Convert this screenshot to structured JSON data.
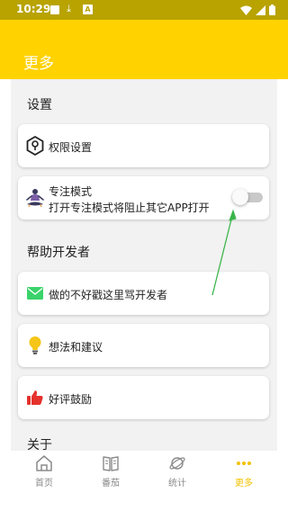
{
  "status_bar": {
    "time": "10:29",
    "download_glyph": "⤓",
    "notification_letter": "A",
    "icons": [
      "square-notification-icon",
      "download-icon",
      "a-notification-icon",
      "wifi-icon",
      "signal-icon",
      "battery-icon"
    ]
  },
  "app_bar": {
    "title": "更多",
    "color": "#ffd200"
  },
  "settings": {
    "title": "设置",
    "permissions": {
      "label": "权限设置",
      "icon": "location-pin-icon"
    },
    "focus_mode": {
      "label": "专注模式",
      "description": "打开专注模式将阻止其它APP打开",
      "icon": "meditation-icon",
      "toggle_on": false
    }
  },
  "help": {
    "title": "帮助开发者",
    "items": [
      {
        "label": "做的不好戳这里骂开发者",
        "icon": "mail-icon",
        "color": "#3ad36b"
      },
      {
        "label": "想法和建议",
        "icon": "lightbulb-icon",
        "color": "#f5c518"
      },
      {
        "label": "好评鼓励",
        "icon": "thumbs-up-icon",
        "color": "#e5322d"
      }
    ]
  },
  "about": {
    "title": "关于"
  },
  "annotation": {
    "arrow_color": "#3ab54a"
  },
  "tabs": [
    {
      "label": "首页",
      "icon": "home-icon",
      "active": false
    },
    {
      "label": "番茄",
      "icon": "book-icon",
      "active": false
    },
    {
      "label": "统计",
      "icon": "planet-icon",
      "active": false
    },
    {
      "label": "更多",
      "icon": "more-dots-icon",
      "active": true
    }
  ]
}
